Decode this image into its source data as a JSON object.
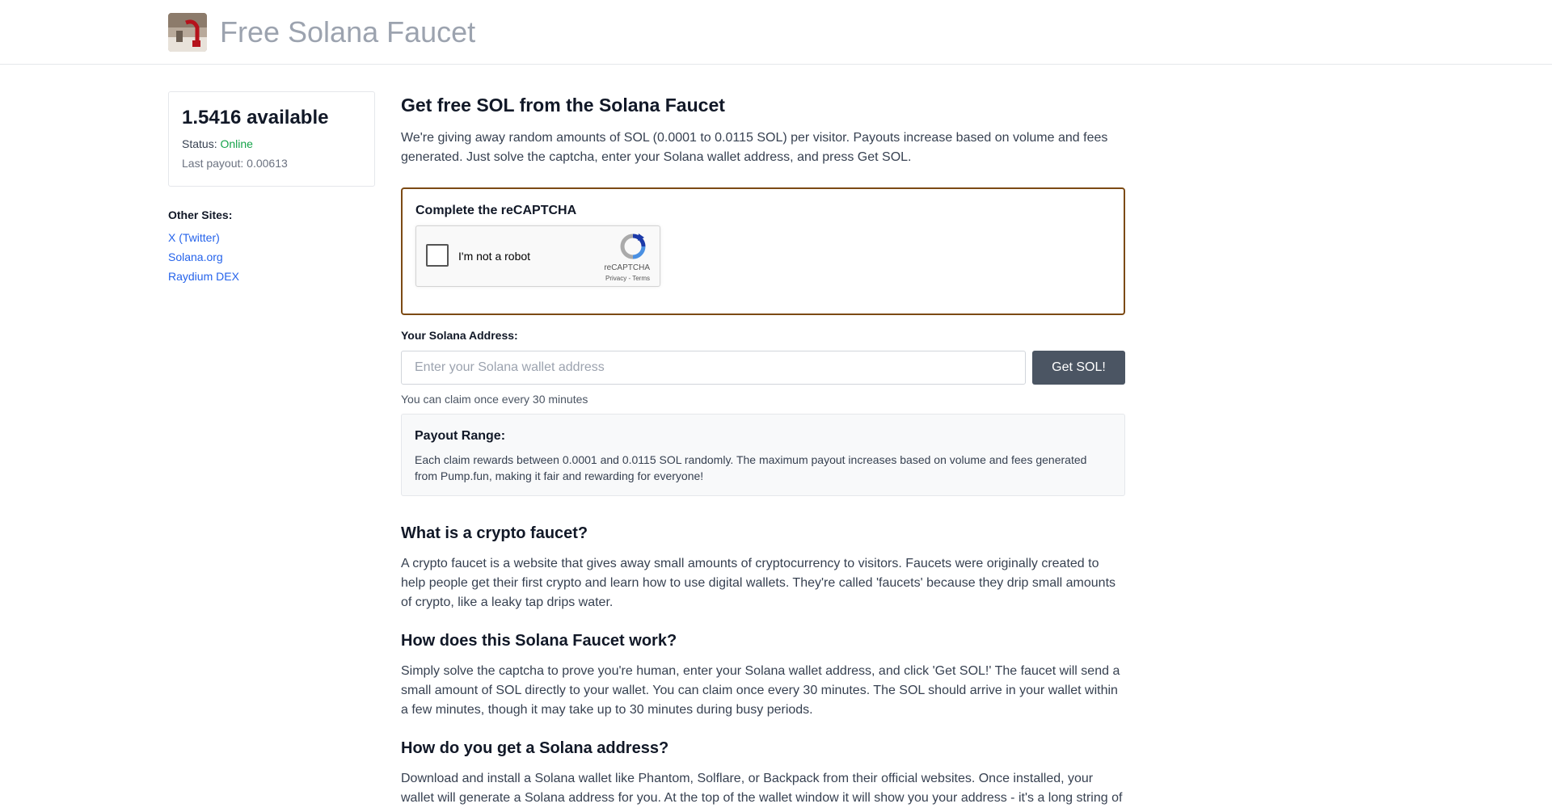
{
  "header": {
    "title": "Free Solana Faucet",
    "logo_icon": "faucet-logo-icon"
  },
  "sidebar": {
    "available": "1.5416 available",
    "status_label": "Status:",
    "status_value": "Online",
    "last_payout": "Last payout: 0.00613",
    "other_sites_title": "Other Sites:",
    "links": [
      {
        "label": "X (Twitter)"
      },
      {
        "label": "Solana.org"
      },
      {
        "label": "Raydium DEX"
      }
    ]
  },
  "main": {
    "heading": "Get free SOL from the Solana Faucet",
    "intro": "We're giving away random amounts of SOL (0.0001 to 0.0115 SOL) per visitor. Payouts increase based on volume and fees generated. Just solve the captcha, enter your Solana wallet address, and press Get SOL.",
    "captcha": {
      "title": "Complete the reCAPTCHA",
      "checkbox_label": "I'm not a robot",
      "brand": "reCAPTCHA",
      "terms": "Privacy - Terms"
    },
    "address": {
      "label": "Your Solana Address:",
      "placeholder": "Enter your Solana wallet address",
      "value": "",
      "button": "Get SOL!",
      "note": "You can claim once every 30 minutes"
    },
    "payout": {
      "title": "Payout Range:",
      "text": "Each claim rewards between 0.0001 and 0.0115 SOL randomly. The maximum payout increases based on volume and fees generated from Pump.fun, making it fair and rewarding for everyone!"
    },
    "faq": [
      {
        "q": "What is a crypto faucet?",
        "a": "A crypto faucet is a website that gives away small amounts of cryptocurrency to visitors. Faucets were originally created to help people get their first crypto and learn how to use digital wallets. They're called 'faucets' because they drip small amounts of crypto, like a leaky tap drips water."
      },
      {
        "q": "How does this Solana Faucet work?",
        "a": "Simply solve the captcha to prove you're human, enter your Solana wallet address, and click 'Get SOL!' The faucet will send a small amount of SOL directly to your wallet. You can claim once every 30 minutes. The SOL should arrive in your wallet within a few minutes, though it may take up to 30 minutes during busy periods."
      },
      {
        "q": "How do you get a Solana address?",
        "a": "Download and install a Solana wallet like Phantom, Solflare, or Backpack from their official websites. Once installed, your wallet will generate a Solana address for you. At the top of the wallet window it will show you your address - it's a long string of"
      }
    ]
  },
  "colors": {
    "status_online": "#16a34a",
    "link": "#2563eb",
    "captcha_border": "#7c4a14",
    "button": "#4b5563"
  }
}
